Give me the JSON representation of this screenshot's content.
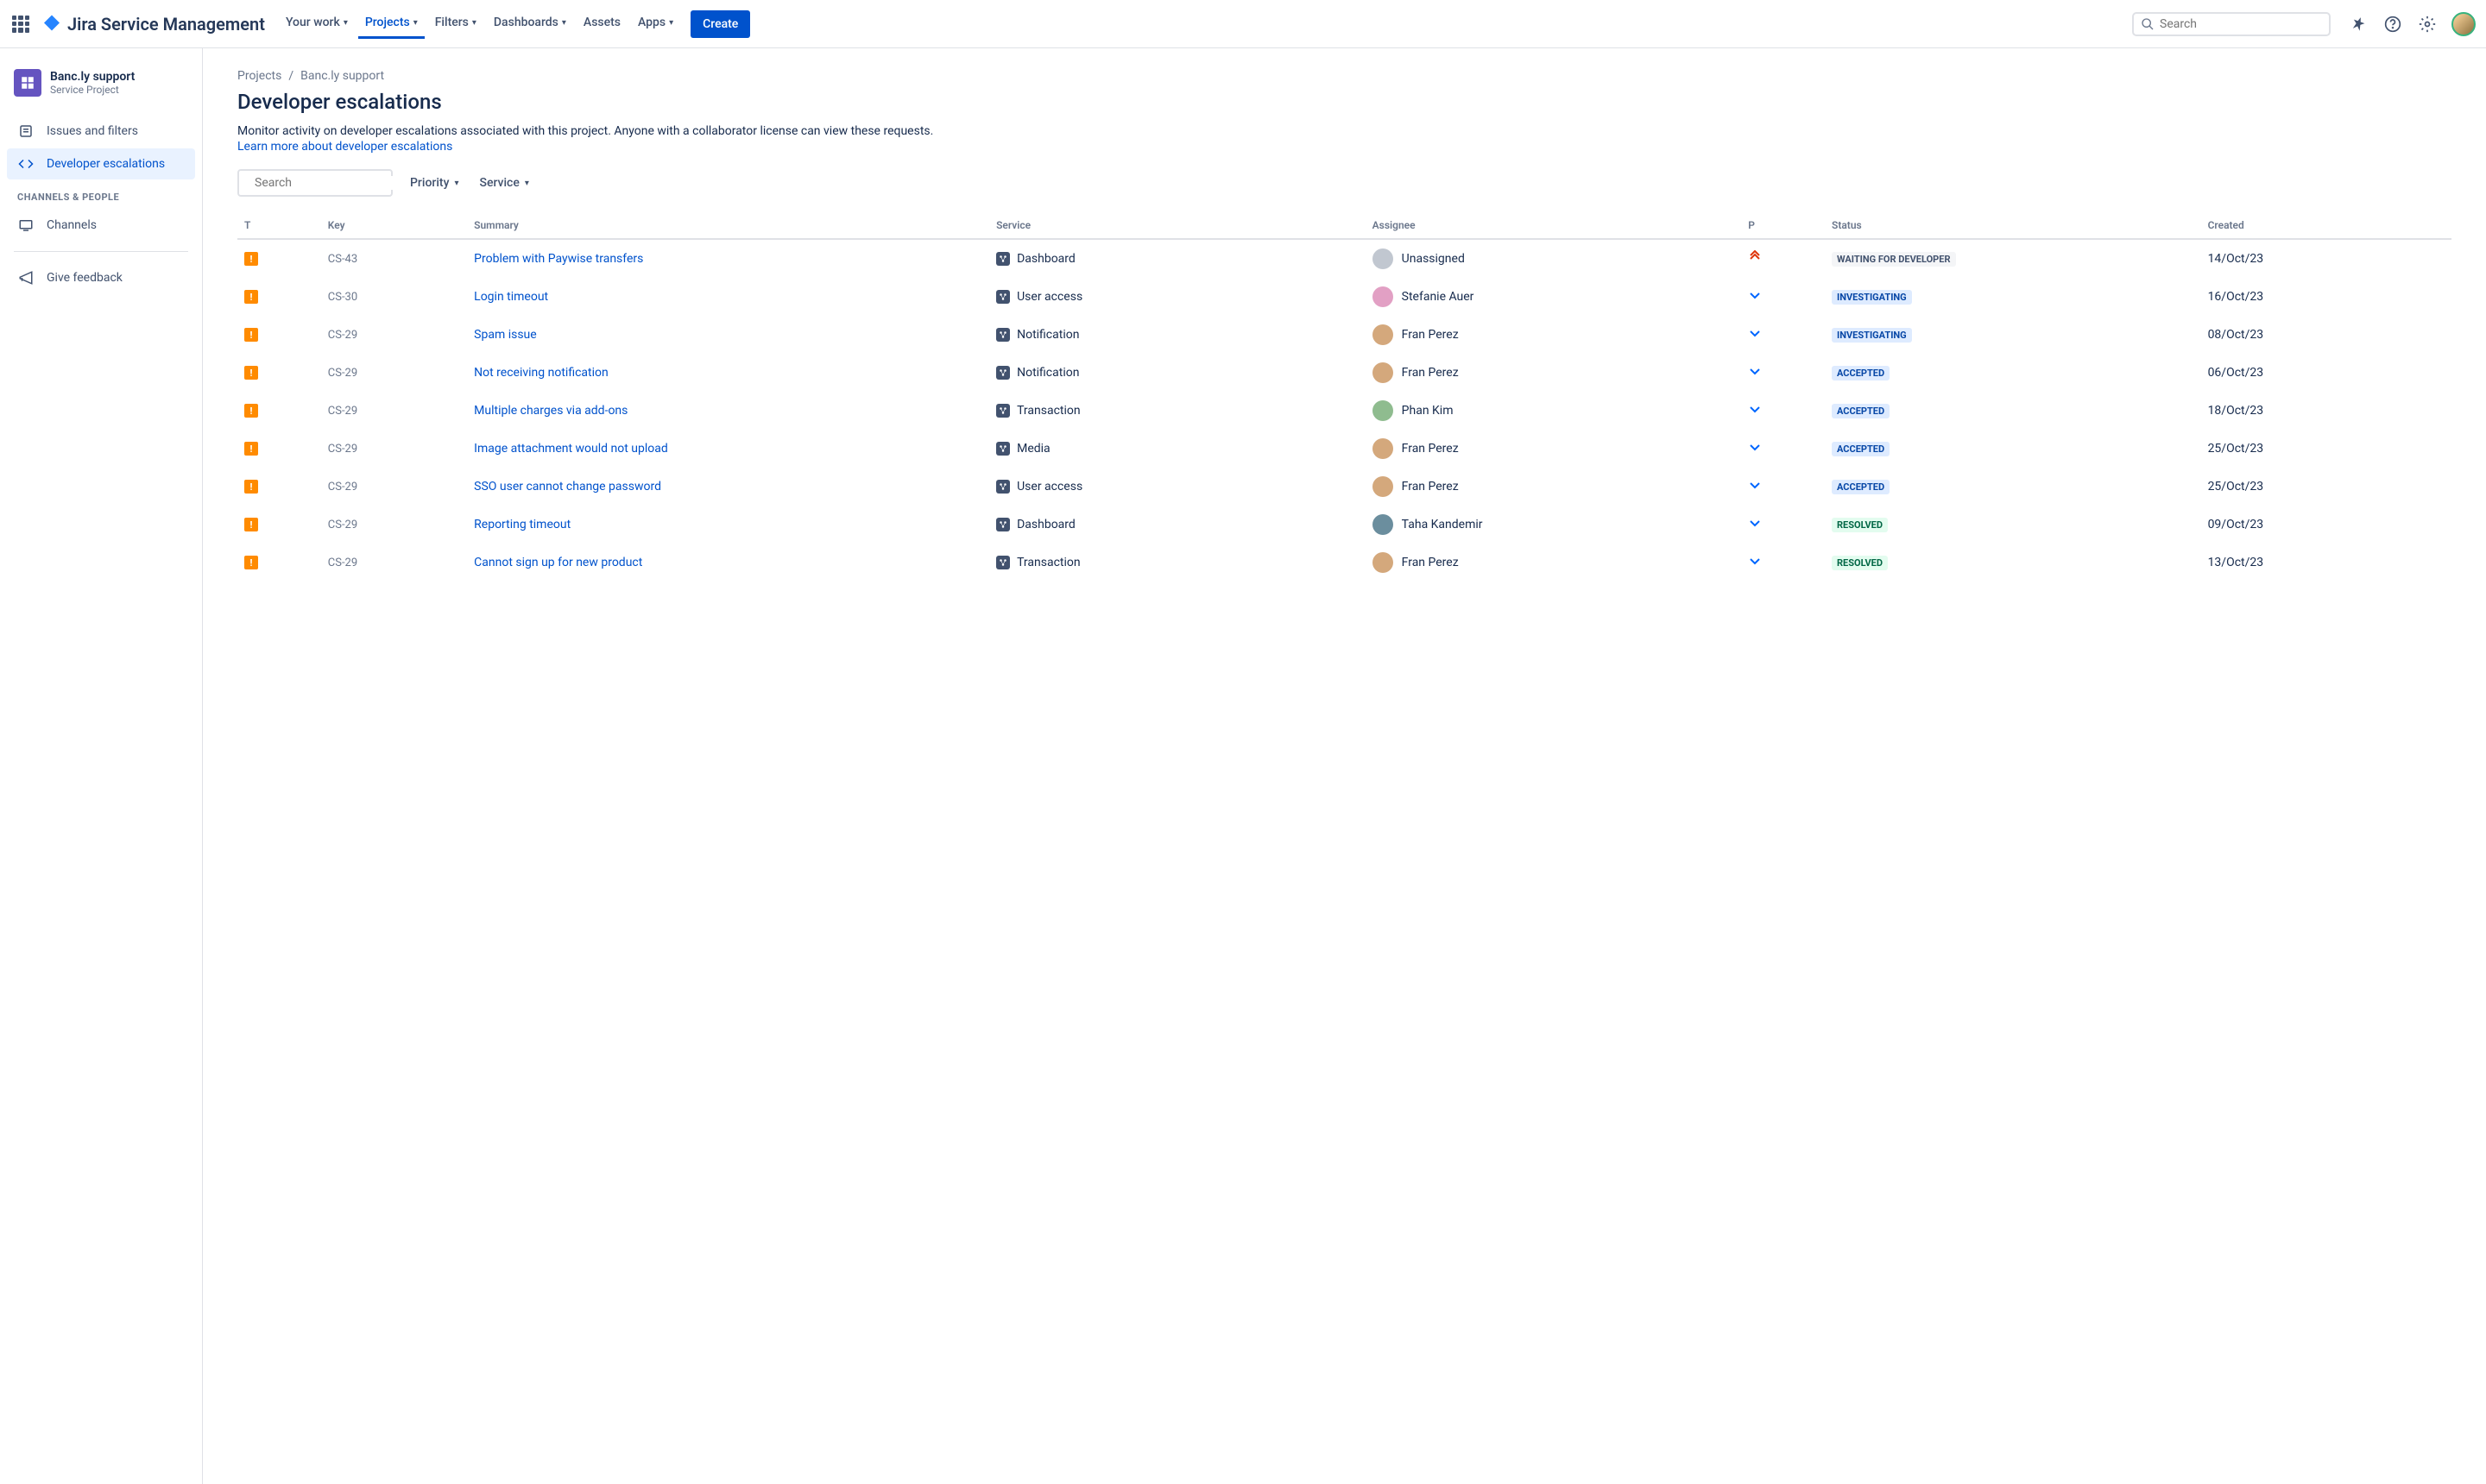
{
  "topbar": {
    "product_name": "Jira Service Management",
    "nav": [
      {
        "label": "Your work",
        "has_chev": true
      },
      {
        "label": "Projects",
        "has_chev": true,
        "active": true
      },
      {
        "label": "Filters",
        "has_chev": true
      },
      {
        "label": "Dashboards",
        "has_chev": true
      },
      {
        "label": "Assets",
        "has_chev": false
      },
      {
        "label": "Apps",
        "has_chev": true
      }
    ],
    "create_label": "Create",
    "search_placeholder": "Search"
  },
  "sidebar": {
    "project_name": "Banc.ly support",
    "project_type": "Service Project",
    "items": [
      {
        "label": "Issues and filters",
        "icon": "issues"
      },
      {
        "label": "Developer escalations",
        "icon": "code",
        "active": true
      }
    ],
    "section_label": "CHANNELS & PEOPLE",
    "channels_label": "Channels",
    "feedback_label": "Give feedback"
  },
  "breadcrumb": {
    "crumb1": "Projects",
    "crumb2": "Banc.ly support"
  },
  "page": {
    "title": "Developer escalations",
    "desc": "Monitor activity on developer escalations associated with this project. Anyone with a collaborator license can view these requests.",
    "learn_more": "Learn more about developer escalations"
  },
  "filters": {
    "search_placeholder": "Search",
    "priority_label": "Priority",
    "service_label": "Service"
  },
  "table": {
    "headers": {
      "t": "T",
      "key": "Key",
      "summary": "Summary",
      "service": "Service",
      "assignee": "Assignee",
      "p": "P",
      "status": "Status",
      "created": "Created"
    },
    "rows": [
      {
        "key": "CS-43",
        "summary": "Problem with Paywise transfers",
        "service": "Dashboard",
        "assignee": "Unassigned",
        "assignee_unassigned": true,
        "priority": "highest",
        "status": "WAITING FOR DEVELOPER",
        "status_cat": "default",
        "created": "14/Oct/23"
      },
      {
        "key": "CS-30",
        "summary": "Login timeout",
        "service": "User access",
        "assignee": "Stefanie Auer",
        "priority": "low",
        "status": "INVESTIGATING",
        "status_cat": "progress",
        "created": "16/Oct/23"
      },
      {
        "key": "CS-29",
        "summary": "Spam issue",
        "service": "Notification",
        "assignee": "Fran Perez",
        "priority": "low",
        "status": "INVESTIGATING",
        "status_cat": "progress",
        "created": "08/Oct/23"
      },
      {
        "key": "CS-29",
        "summary": "Not receiving notification",
        "service": "Notification",
        "assignee": "Fran Perez",
        "priority": "low",
        "status": "ACCEPTED",
        "status_cat": "progress",
        "created": "06/Oct/23"
      },
      {
        "key": "CS-29",
        "summary": "Multiple charges via add-ons",
        "service": "Transaction",
        "assignee": "Phan Kim",
        "priority": "low",
        "status": "ACCEPTED",
        "status_cat": "progress",
        "created": "18/Oct/23"
      },
      {
        "key": "CS-29",
        "summary": "Image attachment would not upload",
        "service": "Media",
        "assignee": "Fran Perez",
        "priority": "low",
        "status": "ACCEPTED",
        "status_cat": "progress",
        "created": "25/Oct/23"
      },
      {
        "key": "CS-29",
        "summary": "SSO user cannot change password",
        "service": "User access",
        "assignee": "Fran Perez",
        "priority": "low",
        "status": "ACCEPTED",
        "status_cat": "progress",
        "created": "25/Oct/23"
      },
      {
        "key": "CS-29",
        "summary": "Reporting timeout",
        "service": "Dashboard",
        "assignee": "Taha Kandemir",
        "priority": "low",
        "status": "RESOLVED",
        "status_cat": "done",
        "created": "09/Oct/23"
      },
      {
        "key": "CS-29",
        "summary": "Cannot sign up for new product",
        "service": "Transaction",
        "assignee": "Fran Perez",
        "priority": "low",
        "status": "RESOLVED",
        "status_cat": "done",
        "created": "13/Oct/23"
      }
    ]
  }
}
